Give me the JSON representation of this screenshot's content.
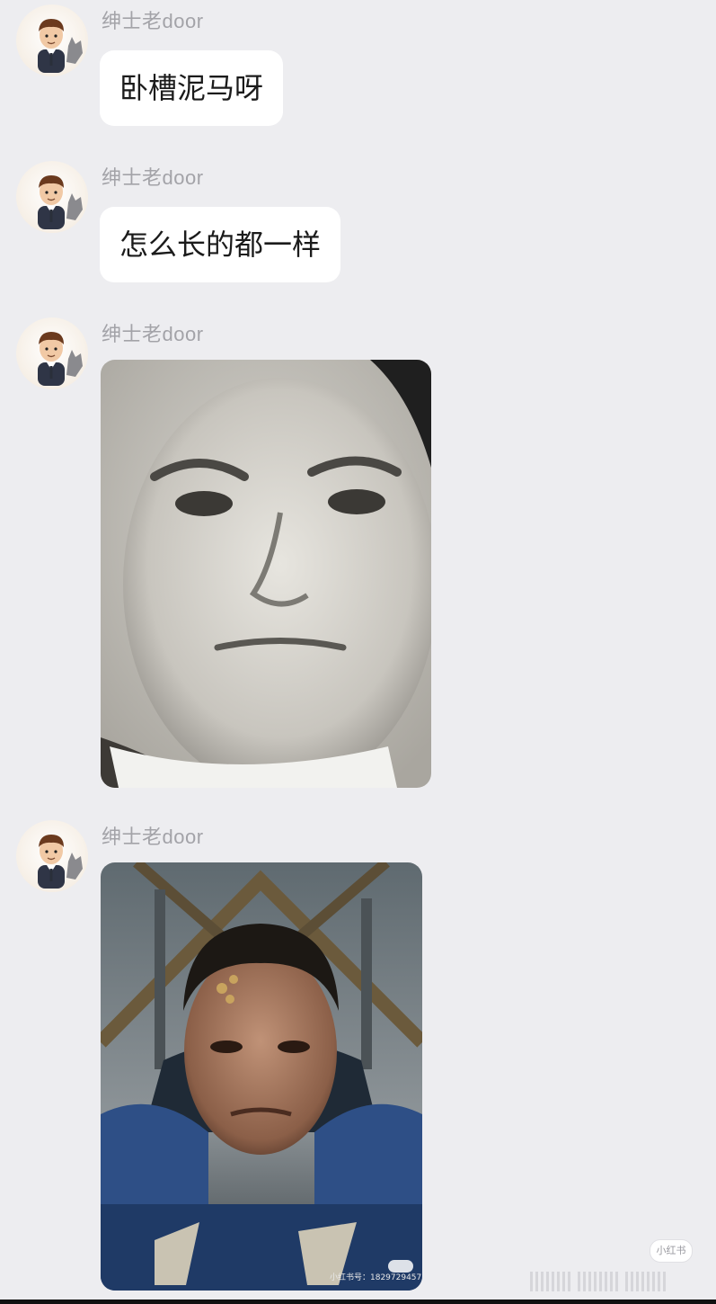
{
  "messages": [
    {
      "sender": "绅士老door",
      "type": "text",
      "text": "卧槽泥马呀"
    },
    {
      "sender": "绅士老door",
      "type": "text",
      "text": "怎么长的都一样"
    },
    {
      "sender": "绅士老door",
      "type": "image",
      "icon": "vintage-portrait-photo"
    },
    {
      "sender": "绅士老door",
      "type": "image",
      "icon": "armored-soldier-portrait-photo",
      "watermark": "小红书号：1829729457"
    }
  ],
  "badge": "小红书",
  "colors": {
    "background": "#ededf0",
    "bubble": "#ffffff",
    "name": "#a3a3a8"
  }
}
